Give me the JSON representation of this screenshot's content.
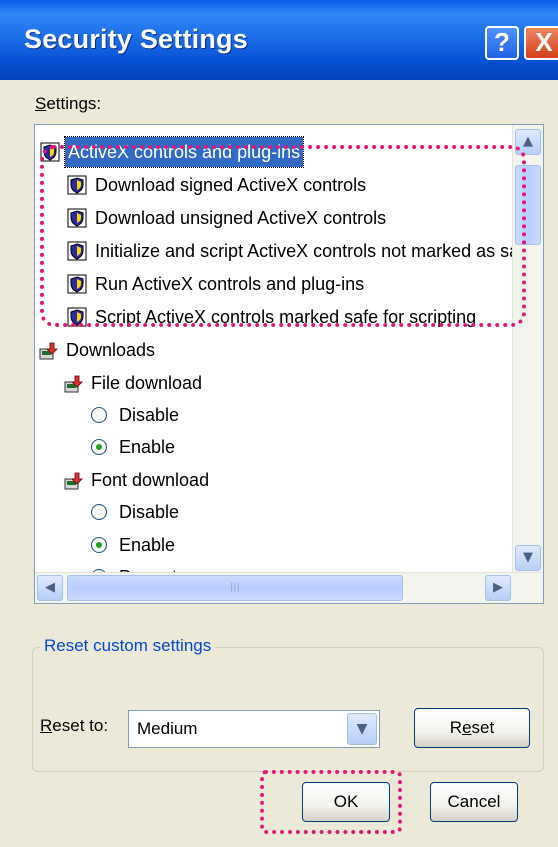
{
  "window": {
    "title": "Security Settings",
    "help_label": "?",
    "close_label": "X"
  },
  "settings_label_first": "S",
  "settings_label_rest": "ettings:",
  "tree": {
    "root": "ActiveX controls and plug-ins",
    "activex_items": [
      "Download signed ActiveX controls",
      "Download unsigned ActiveX controls",
      "Initialize and script ActiveX controls not marked as safe",
      "Run ActiveX controls and plug-ins",
      "Script ActiveX controls marked safe for scripting"
    ],
    "downloads": "Downloads",
    "file_download": "File download",
    "file_options": [
      "Disable",
      "Enable"
    ],
    "font_download": "Font download",
    "font_options": [
      "Disable",
      "Enable",
      "Prompt"
    ]
  },
  "reset_group": {
    "legend": "Reset custom settings",
    "reset_to_label_first": "R",
    "reset_to_label_rest": "eset to:",
    "selected_value": "Medium",
    "reset_button_first": "R",
    "reset_button_mid": "e",
    "reset_button_rest": "set"
  },
  "buttons": {
    "ok": "OK",
    "cancel": "Cancel"
  },
  "icons": {
    "shield": "shield-icon",
    "download": "download-icon"
  },
  "colors": {
    "highlight": "#e0187a",
    "selection": "#316ac5",
    "titlebar": "#0753d6"
  }
}
